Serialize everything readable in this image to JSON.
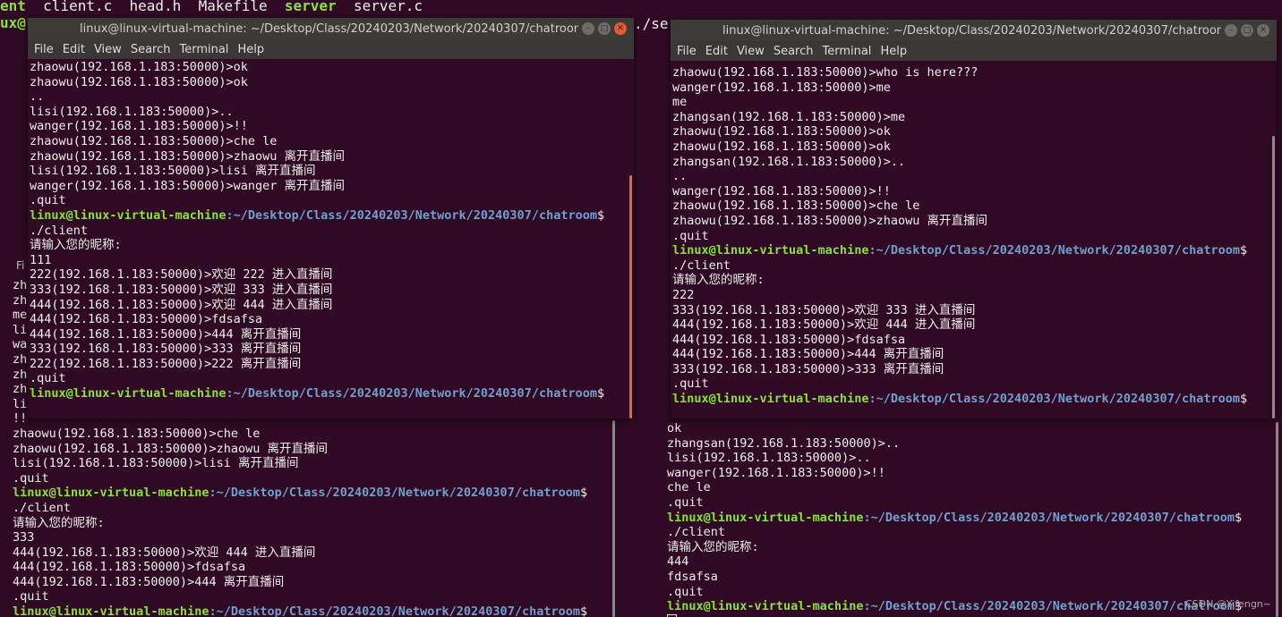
{
  "top_strip": {
    "prefix": "ent",
    "files": [
      "client.c",
      "head.h",
      "Makefile"
    ],
    "exec": "server",
    "file_last": "server.c",
    "second_line": "ux@"
  },
  "bg_fragment": "./ser",
  "bottom_left": {
    "lines": [
      {
        "t": "zh"
      },
      {
        "t": "zh"
      },
      {
        "t": "me"
      },
      {
        "t": "li"
      },
      {
        "t": "wa"
      },
      {
        "t": "zh"
      },
      {
        "t": "zh"
      },
      {
        "t": "zh"
      },
      {
        "t": "li"
      },
      {
        "t": "!!"
      },
      {
        "t": "zhaowu(192.168.1.183:50000)>che le"
      },
      {
        "t": "zhaowu(192.168.1.183:50000)>zhaowu 离开直播间"
      },
      {
        "t": "lisi(192.168.1.183:50000)>lisi 离开直播间"
      },
      {
        "t": ".quit"
      },
      {
        "p": true
      },
      {
        "t": "./client"
      },
      {
        "t": "请输入您的昵称:"
      },
      {
        "t": "333"
      },
      {
        "t": "444(192.168.1.183:50000)>欢迎 444 进入直播间"
      },
      {
        "t": "444(192.168.1.183:50000)>fdsafsa"
      },
      {
        "t": "444(192.168.1.183:50000)>444 离开直播间"
      },
      {
        "t": ".quit"
      },
      {
        "p": true
      }
    ],
    "side_label": "Fi"
  },
  "prompt": {
    "user": "linux@linux-virtual-machine",
    "path": ":~/Desktop/Class/20240203/Network/20240307/chatroom",
    "sigil": "$"
  },
  "win_a": {
    "title": "linux@linux-virtual-machine: ~/Desktop/Class/20240203/Network/20240307/chatroom",
    "menu": [
      "File",
      "Edit",
      "View",
      "Search",
      "Terminal",
      "Help"
    ],
    "lines": [
      {
        "t": "zhaowu(192.168.1.183:50000)>ok"
      },
      {
        "t": "zhaowu(192.168.1.183:50000)>ok"
      },
      {
        "t": ".."
      },
      {
        "t": "lisi(192.168.1.183:50000)>.."
      },
      {
        "t": "wanger(192.168.1.183:50000)>!!"
      },
      {
        "t": "zhaowu(192.168.1.183:50000)>che le"
      },
      {
        "t": "zhaowu(192.168.1.183:50000)>zhaowu 离开直播间"
      },
      {
        "t": "lisi(192.168.1.183:50000)>lisi 离开直播间"
      },
      {
        "t": "wanger(192.168.1.183:50000)>wanger 离开直播间"
      },
      {
        "t": ".quit"
      },
      {
        "p": true
      },
      {
        "t": "./client"
      },
      {
        "t": "请输入您的昵称:"
      },
      {
        "t": "111"
      },
      {
        "t": "222(192.168.1.183:50000)>欢迎 222 进入直播间"
      },
      {
        "t": "333(192.168.1.183:50000)>欢迎 333 进入直播间"
      },
      {
        "t": "444(192.168.1.183:50000)>欢迎 444 进入直播间"
      },
      {
        "t": "444(192.168.1.183:50000)>fdsafsa"
      },
      {
        "t": "444(192.168.1.183:50000)>444 离开直播间"
      },
      {
        "t": "333(192.168.1.183:50000)>333 离开直播间"
      },
      {
        "t": "222(192.168.1.183:50000)>222 离开直播间"
      },
      {
        "t": ".quit"
      },
      {
        "p": true
      }
    ]
  },
  "win_b": {
    "title": "linux@linux-virtual-machine: ~/Desktop/Class/20240203/Network/20240307/chatroom",
    "menu": [
      "File",
      "Edit",
      "View",
      "Search",
      "Terminal",
      "Help"
    ],
    "lines": [
      {
        "t": "zhaowu(192.168.1.183:50000)>who is here???"
      },
      {
        "t": "wanger(192.168.1.183:50000)>me"
      },
      {
        "t": "me"
      },
      {
        "t": "zhangsan(192.168.1.183:50000)>me"
      },
      {
        "t": "zhaowu(192.168.1.183:50000)>ok"
      },
      {
        "t": "zhaowu(192.168.1.183:50000)>ok"
      },
      {
        "t": "zhangsan(192.168.1.183:50000)>.."
      },
      {
        "t": ".."
      },
      {
        "t": "wanger(192.168.1.183:50000)>!!"
      },
      {
        "t": "zhaowu(192.168.1.183:50000)>che le"
      },
      {
        "t": "zhaowu(192.168.1.183:50000)>zhaowu 离开直播间"
      },
      {
        "t": ".quit"
      },
      {
        "p": true
      },
      {
        "t": "./client"
      },
      {
        "t": "请输入您的昵称:"
      },
      {
        "t": "222"
      },
      {
        "t": "333(192.168.1.183:50000)>欢迎 333 进入直播间"
      },
      {
        "t": "444(192.168.1.183:50000)>欢迎 444 进入直播间"
      },
      {
        "t": "444(192.168.1.183:50000)>fdsafsa"
      },
      {
        "t": "444(192.168.1.183:50000)>444 离开直播间"
      },
      {
        "t": "333(192.168.1.183:50000)>333 离开直播间"
      },
      {
        "t": ".quit"
      },
      {
        "p": true
      }
    ]
  },
  "bottom_right": {
    "lines": [
      {
        "t": "ok"
      },
      {
        "t": "zhangsan(192.168.1.183:50000)>.."
      },
      {
        "t": "lisi(192.168.1.183:50000)>.."
      },
      {
        "t": "wanger(192.168.1.183:50000)>!!"
      },
      {
        "t": "che le"
      },
      {
        "t": ".quit"
      },
      {
        "p": true
      },
      {
        "t": "./client"
      },
      {
        "t": "请输入您的昵称:"
      },
      {
        "t": "444"
      },
      {
        "t": "fdsafsa"
      },
      {
        "t": ".quit"
      },
      {
        "p": true
      }
    ]
  },
  "watermark": "CSDN @Yifengn~"
}
